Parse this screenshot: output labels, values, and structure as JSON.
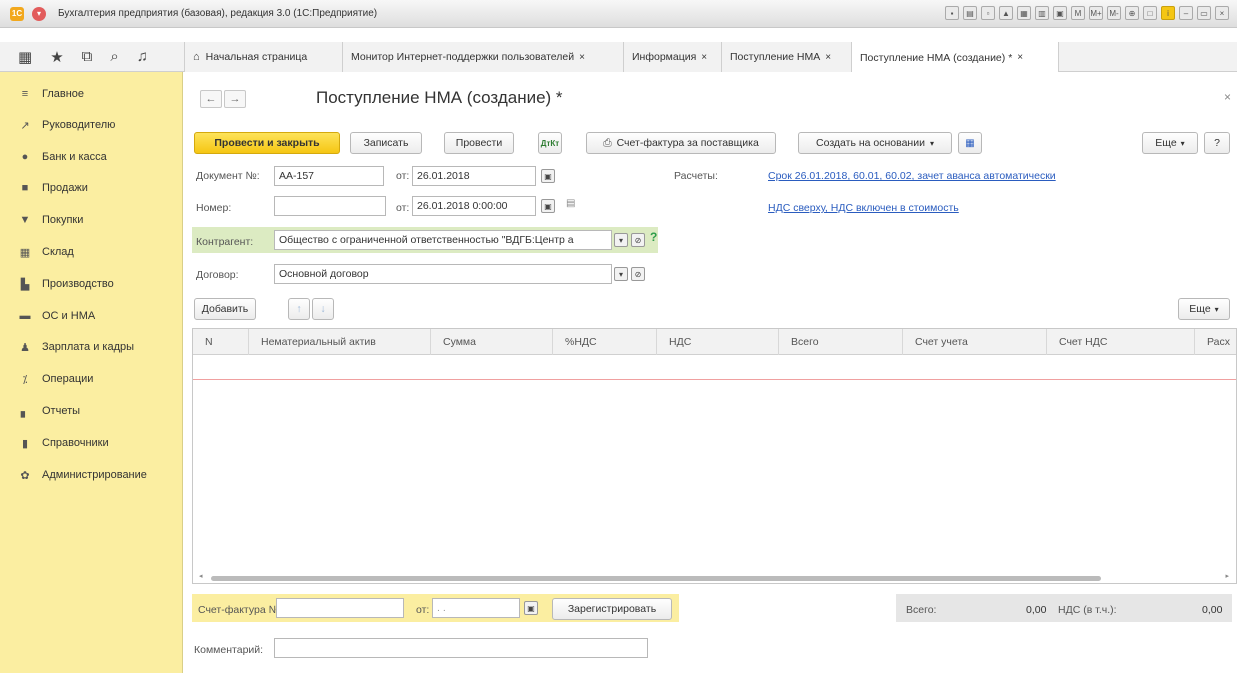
{
  "window": {
    "title": "Бухгалтерия предприятия (базовая), редакция 3.0 (1С:Предприятие)",
    "icons": [
      "M",
      "M+",
      "M-"
    ]
  },
  "tabs": [
    {
      "label": "Начальная страница",
      "closable": false
    },
    {
      "label": "Монитор Интернет-поддержки пользователей",
      "closable": true
    },
    {
      "label": "Информация",
      "closable": true
    },
    {
      "label": "Поступление НМА",
      "closable": true
    },
    {
      "label": "Поступление НМА (создание) *",
      "closable": true,
      "active": true
    }
  ],
  "sidebar": {
    "items": [
      {
        "label": "Главное",
        "icon": "menu-lines-icon"
      },
      {
        "label": "Руководителю",
        "icon": "trend-chart-icon"
      },
      {
        "label": "Банк и касса",
        "icon": "coin-icon"
      },
      {
        "label": "Продажи",
        "icon": "bag-icon"
      },
      {
        "label": "Покупки",
        "icon": "cart-icon"
      },
      {
        "label": "Склад",
        "icon": "warehouse-icon"
      },
      {
        "label": "Производство",
        "icon": "factory-icon"
      },
      {
        "label": "ОС и НМА",
        "icon": "truck-icon"
      },
      {
        "label": "Зарплата и кадры",
        "icon": "person-icon"
      },
      {
        "label": "Операции",
        "icon": "operations-icon"
      },
      {
        "label": "Отчеты",
        "icon": "bar-chart-icon"
      },
      {
        "label": "Справочники",
        "icon": "books-icon"
      },
      {
        "label": "Администрирование",
        "icon": "gear-icon"
      }
    ]
  },
  "document": {
    "title": "Поступление НМА (создание) *",
    "buttons": {
      "post_close": "Провести и закрыть",
      "save": "Записать",
      "post": "Провести",
      "invoice": "Счет-фактура за поставщика",
      "create_based": "Создать на основании",
      "more": "Еще",
      "help": "?"
    },
    "doc_number_label": "Документ №:",
    "doc_number": "АА-157",
    "from_label": "от:",
    "doc_date": "26.01.2018",
    "number_label": "Номер:",
    "number_value": "",
    "from_label2": "от:",
    "number_date": "26.01.2018  0:00:00",
    "settlements_label": "Расчеты:",
    "settlements_link": "Срок 26.01.2018, 60.01, 60.02, зачет аванса автоматически",
    "vat_link": "НДС сверху, НДС включен в стоимость",
    "counterparty_label": "Контрагент:",
    "counterparty": "Общество с ограниченной ответственностью \"ВДГБ:Центр а",
    "contract_label": "Договор:",
    "contract": "Основной договор"
  },
  "table": {
    "add_button": "Добавить",
    "more_button": "Еще",
    "columns": [
      "N",
      "Нематериальный актив",
      "Сумма",
      "%НДС",
      "НДС",
      "Всего",
      "Счет учета",
      "Счет НДС",
      "Расх"
    ],
    "rows": []
  },
  "footer": {
    "invoice_label": "Счет-фактура №:",
    "invoice_number": "",
    "from_label": "от:",
    "invoice_date": " .  .",
    "register_button": "Зарегистрировать",
    "total_label": "Всего:",
    "total_value": "0,00",
    "vat_label": "НДС (в т.ч.):",
    "vat_value": "0,00",
    "comment_label": "Комментарий:",
    "comment": ""
  }
}
